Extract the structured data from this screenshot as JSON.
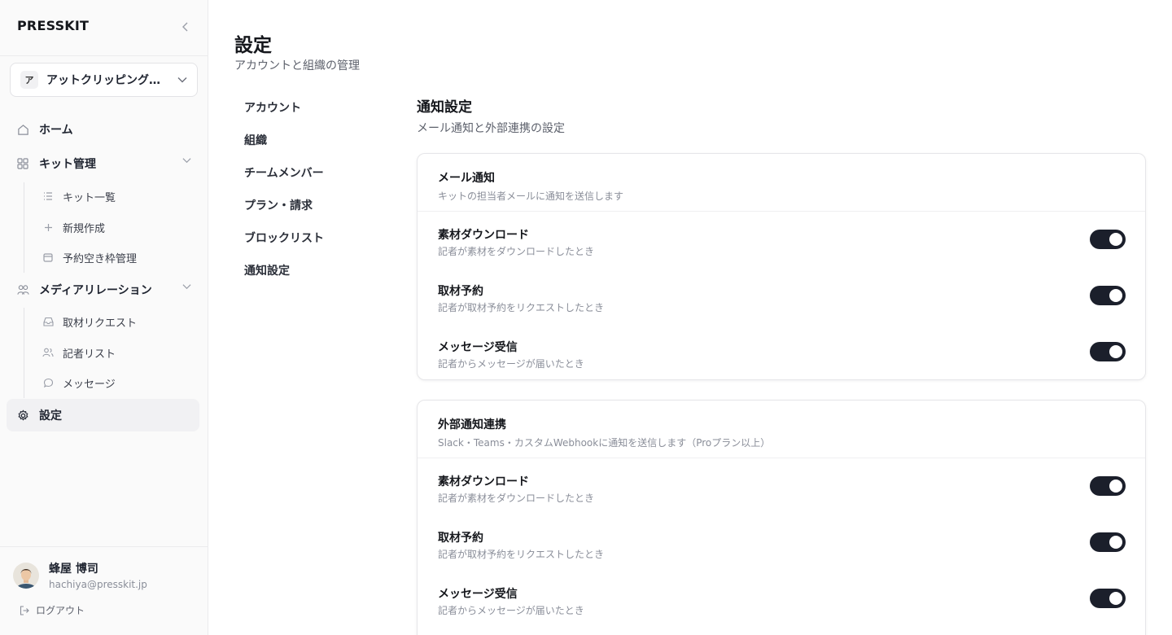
{
  "sidebar": {
    "brand": "PRESSKIT",
    "org": {
      "initial": "ア",
      "name": "アットクリッピング株式会社"
    },
    "nav": {
      "home": "ホーム",
      "kit": "キット管理",
      "kit_list": "キット一覧",
      "kit_new": "新規作成",
      "kit_slots": "予約空き枠管理",
      "media": "メディアリレーション",
      "requests": "取材リクエスト",
      "reporters": "記者リスト",
      "messages": "メッセージ",
      "settings": "設定"
    },
    "user": {
      "name": "蜂屋 博司",
      "email": "hachiya@presskit.jp"
    },
    "logout": "ログアウト"
  },
  "page": {
    "title": "設定",
    "subtitle": "アカウントと組織の管理"
  },
  "settings_nav": [
    "アカウント",
    "組織",
    "チームメンバー",
    "プラン・請求",
    "ブロックリスト",
    "通知設定"
  ],
  "section": {
    "title": "通知設定",
    "subtitle": "メール通知と外部連携の設定"
  },
  "cards": [
    {
      "title": "メール通知",
      "desc": "キットの担当者メールに通知を送信します",
      "rows": [
        {
          "title": "素材ダウンロード",
          "desc": "記者が素材をダウンロードしたとき",
          "on": true
        },
        {
          "title": "取材予約",
          "desc": "記者が取材予約をリクエストしたとき",
          "on": true
        },
        {
          "title": "メッセージ受信",
          "desc": "記者からメッセージが届いたとき",
          "on": true
        }
      ]
    },
    {
      "title": "外部通知連携",
      "desc": "Slack・Teams・カスタムWebhookに通知を送信します（Proプラン以上）",
      "rows": [
        {
          "title": "素材ダウンロード",
          "desc": "記者が素材をダウンロードしたとき",
          "on": true
        },
        {
          "title": "取材予約",
          "desc": "記者が取材予約をリクエストしたとき",
          "on": true
        },
        {
          "title": "メッセージ受信",
          "desc": "記者からメッセージが届いたとき",
          "on": true
        }
      ]
    }
  ],
  "colors": {
    "toggle_on": "#1b1f2b",
    "sidebar_bg": "#fafafa",
    "active_bg": "#f1f1f3"
  },
  "icons": [
    "chevron-left-icon",
    "chevron-down-icon",
    "home-icon",
    "grid-icon",
    "list-icon",
    "plus-icon",
    "calendar-icon",
    "users-icon",
    "inbox-icon",
    "user-group-icon",
    "chat-icon",
    "gear-icon",
    "logout-icon"
  ]
}
